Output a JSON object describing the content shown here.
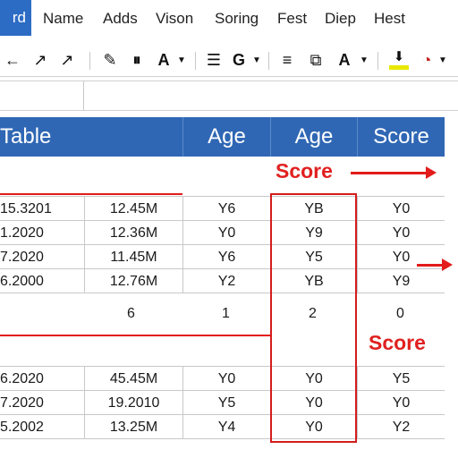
{
  "menubar": {
    "app_tab": "rd",
    "items": [
      "Name",
      "Adds",
      "Vison",
      "Soring",
      "Fest",
      "Diep",
      "Hest"
    ]
  },
  "toolbar": {
    "buttons": [
      {
        "name": "undo-icon",
        "glyph": "←"
      },
      {
        "name": "arrow-up-right-icon",
        "glyph": "↗"
      },
      {
        "name": "pointer-arrow-icon",
        "glyph": "↗"
      },
      {
        "name": "pen-icon",
        "glyph": "✎"
      },
      {
        "name": "pause-icon",
        "glyph": "⏸"
      },
      {
        "name": "font-a-icon",
        "glyph": "A"
      },
      {
        "name": "align-icon",
        "glyph": "☰"
      },
      {
        "name": "font-g-icon",
        "glyph": "G"
      },
      {
        "name": "list-icon",
        "glyph": "≡"
      },
      {
        "name": "image-icon",
        "glyph": "⧉"
      },
      {
        "name": "font-color-icon",
        "glyph": "A"
      },
      {
        "name": "download-icon",
        "glyph": "⬇"
      },
      {
        "name": "clock-icon",
        "glyph": "◔"
      }
    ],
    "highlight_color": "#e8e800"
  },
  "table": {
    "title": "Table",
    "headers": [
      "Age",
      "Age",
      "Score"
    ],
    "section1": [
      [
        "15.3201",
        "12.45M",
        "Y6",
        "YB",
        "Y0"
      ],
      [
        "1.2020",
        "12.36M",
        "Y0",
        "Y9",
        "Y0"
      ],
      [
        "7.2020",
        "11.45M",
        "Y6",
        "Y5",
        "Y0"
      ],
      [
        "6.2000",
        "12.76M",
        "Y2",
        "YB",
        "Y9"
      ]
    ],
    "counts": [
      "6",
      "1",
      "2",
      "0"
    ],
    "section2": [
      [
        "6.2020",
        "45.45M",
        "Y0",
        "Y0",
        "Y5"
      ],
      [
        "7.2020",
        "19.2010",
        "Y5",
        "Y0",
        "Y0"
      ],
      [
        "5.2002",
        "13.25M",
        "Y4",
        "Y0",
        "Y2"
      ]
    ]
  },
  "annotations": {
    "score_top": "Score",
    "score_bottom": "Score",
    "color": "#e02020"
  },
  "colors": {
    "header_blue": "#2f67b4",
    "app_tab_blue": "#2d6cc4"
  }
}
